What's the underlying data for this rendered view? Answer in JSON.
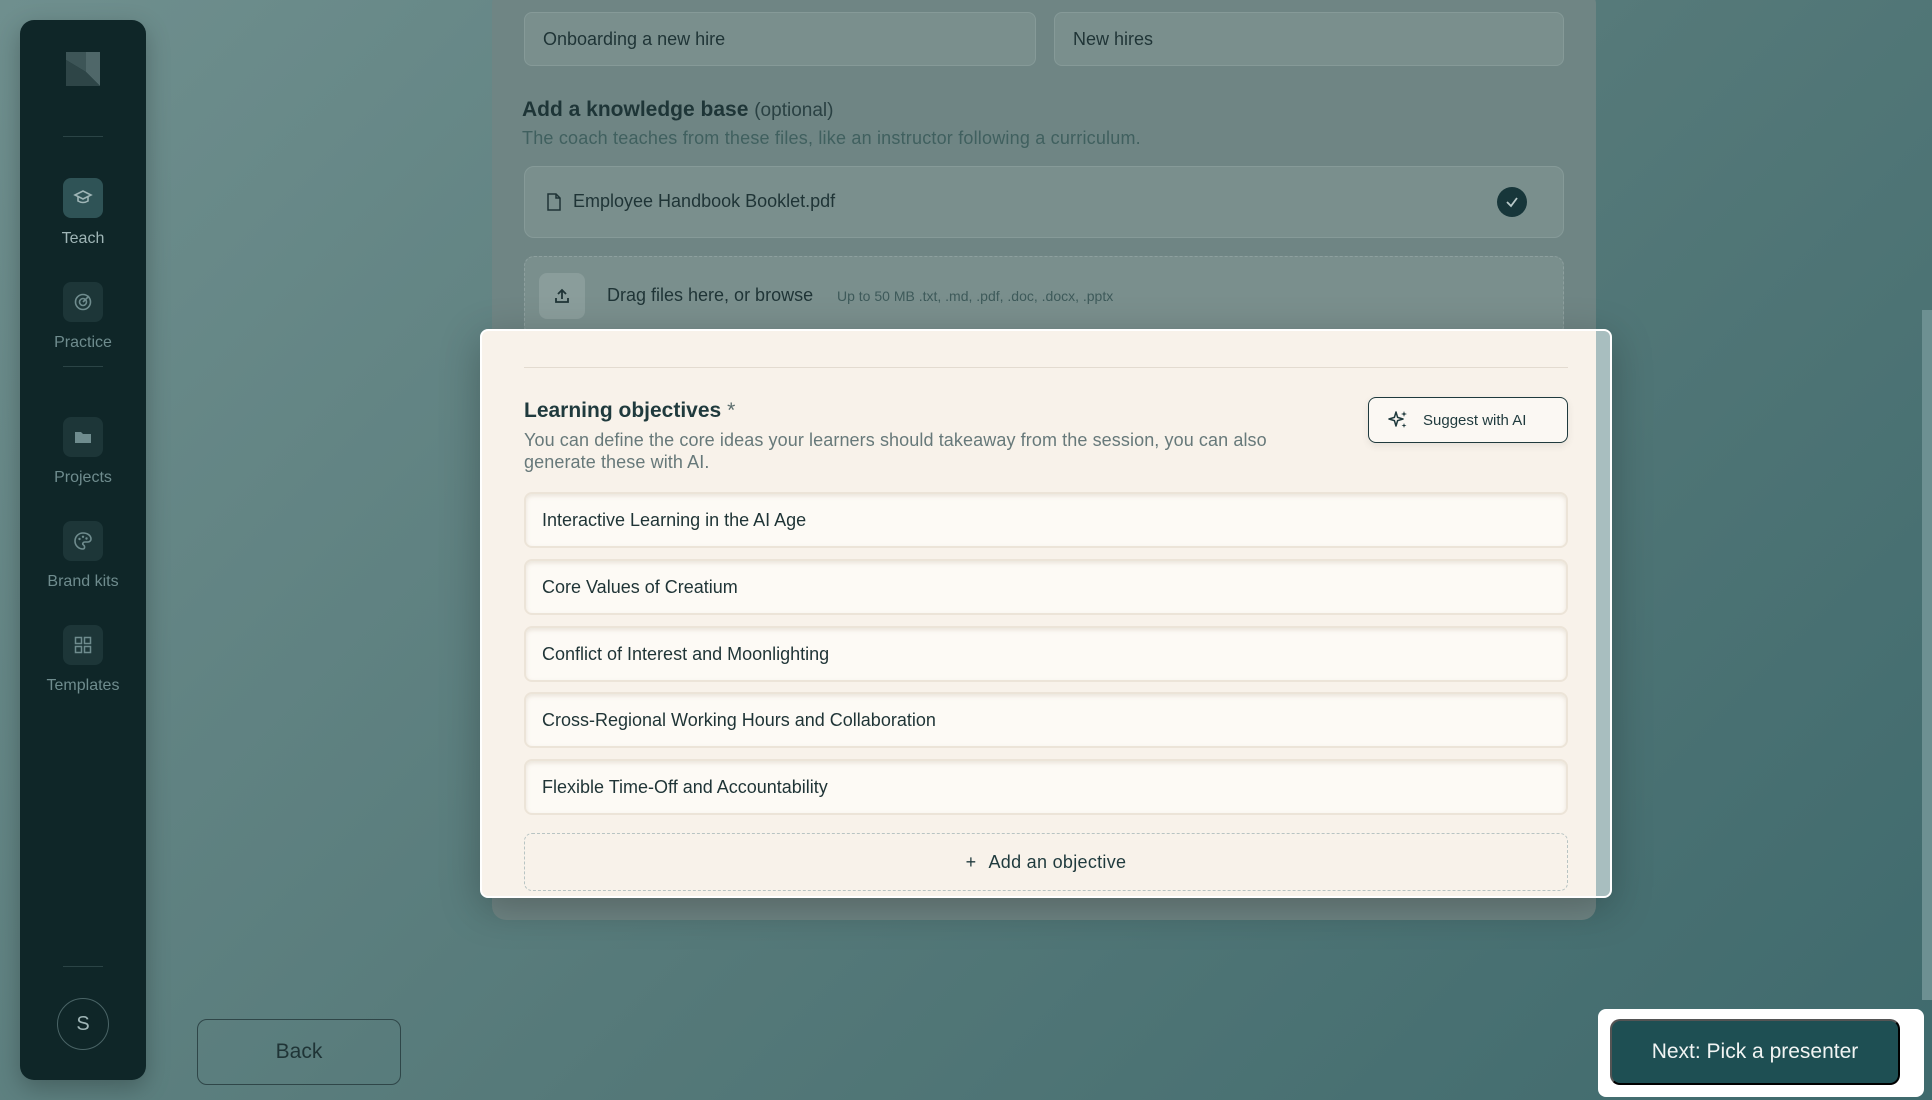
{
  "sidebar": {
    "items": [
      {
        "label": "Teach",
        "icon": "graduation-cap-icon",
        "active": true
      },
      {
        "label": "Practice",
        "icon": "target-icon",
        "active": false
      },
      {
        "label": "Projects",
        "icon": "folder-icon",
        "active": false
      },
      {
        "label": "Brand kits",
        "icon": "palette-icon",
        "active": false
      },
      {
        "label": "Templates",
        "icon": "grid-icon",
        "active": false
      }
    ],
    "avatar_initial": "S"
  },
  "background_form": {
    "topic_value": "Onboarding a new hire",
    "audience_value": "New hires",
    "kb_title": "Add a knowledge base",
    "kb_optional": "(optional)",
    "kb_subtitle": "The coach teaches from these files, like an instructor following a curriculum.",
    "file_name": "Employee Handbook Booklet.pdf",
    "drop_text": "Drag files here, or browse",
    "drop_hint": "Up to 50 MB .txt, .md, .pdf, .doc, .docx, .pptx"
  },
  "modal": {
    "title": "Learning objectives",
    "required_mark": "*",
    "description": "You can define the core ideas your learners should takeaway from the session, you can also generate these with AI.",
    "suggest_label": "Suggest with AI",
    "objectives": [
      "Interactive Learning in the AI Age",
      "Core Values of Creatium",
      "Conflict of Interest and Moonlighting",
      "Cross-Regional Working Hours and Collaboration",
      "Flexible Time-Off and Accountability"
    ],
    "add_label": "Add an objective",
    "add_icon": "+"
  },
  "footer": {
    "back_label": "Back",
    "next_label": "Next: Pick a presenter"
  },
  "colors": {
    "accent": "#1e4f53",
    "sidebar_bg": "#0f2628",
    "modal_bg": "#f8f2ea"
  }
}
